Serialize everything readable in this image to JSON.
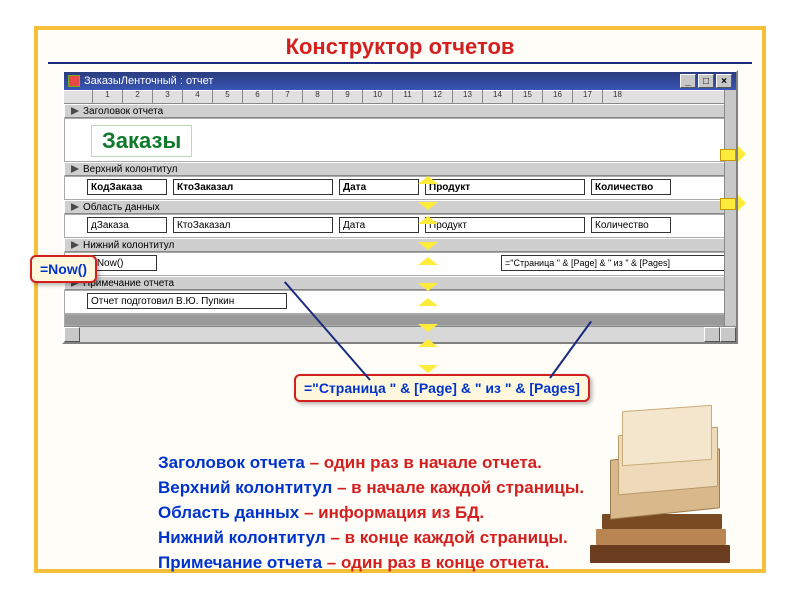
{
  "title": "Конструктор отчетов",
  "window": {
    "caption": "ЗаказыЛенточный : отчет",
    "ruler_marks": [
      "1",
      "2",
      "3",
      "4",
      "5",
      "6",
      "7",
      "8",
      "9",
      "10",
      "11",
      "12",
      "13",
      "14",
      "15",
      "16",
      "17",
      "18"
    ],
    "sections": {
      "report_header": "Заголовок отчета",
      "page_header": "Верхний колонтитул",
      "detail": "Область данных",
      "page_footer": "Нижний колонтитул",
      "report_footer": "Примечание отчета"
    },
    "big_label": "Заказы",
    "headers": [
      "КодЗаказа",
      "КтоЗаказал",
      "Дата",
      "Продукт",
      "Количество"
    ],
    "fields": [
      "дЗаказа",
      "КтоЗаказал",
      "Дата",
      "Продукт",
      "Количество"
    ],
    "footer_left": "=Now()",
    "footer_right": "=\"Страница \" & [Page] & \" из \" & [Pages]",
    "note": "Отчет подготовил В.Ю. Пупкин"
  },
  "callouts": {
    "now": "=Now()",
    "page": "=\"Страница \" & [Page] & \" из \" & [Pages]"
  },
  "desc": [
    {
      "term": "Заголовок отчета",
      "def": " – один раз в начале отчета."
    },
    {
      "term": "Верхний колонтитул",
      "def": " – в начале каждой страницы."
    },
    {
      "term": "Область данных",
      "def": " – информация из БД."
    },
    {
      "term": "Нижний колонтитул",
      "def": " – в конце каждой страницы."
    },
    {
      "term": "Примечание отчета",
      "def": " – один раз в конце отчета."
    }
  ],
  "winbuttons": {
    "min": "_",
    "max": "□",
    "close": "×"
  }
}
